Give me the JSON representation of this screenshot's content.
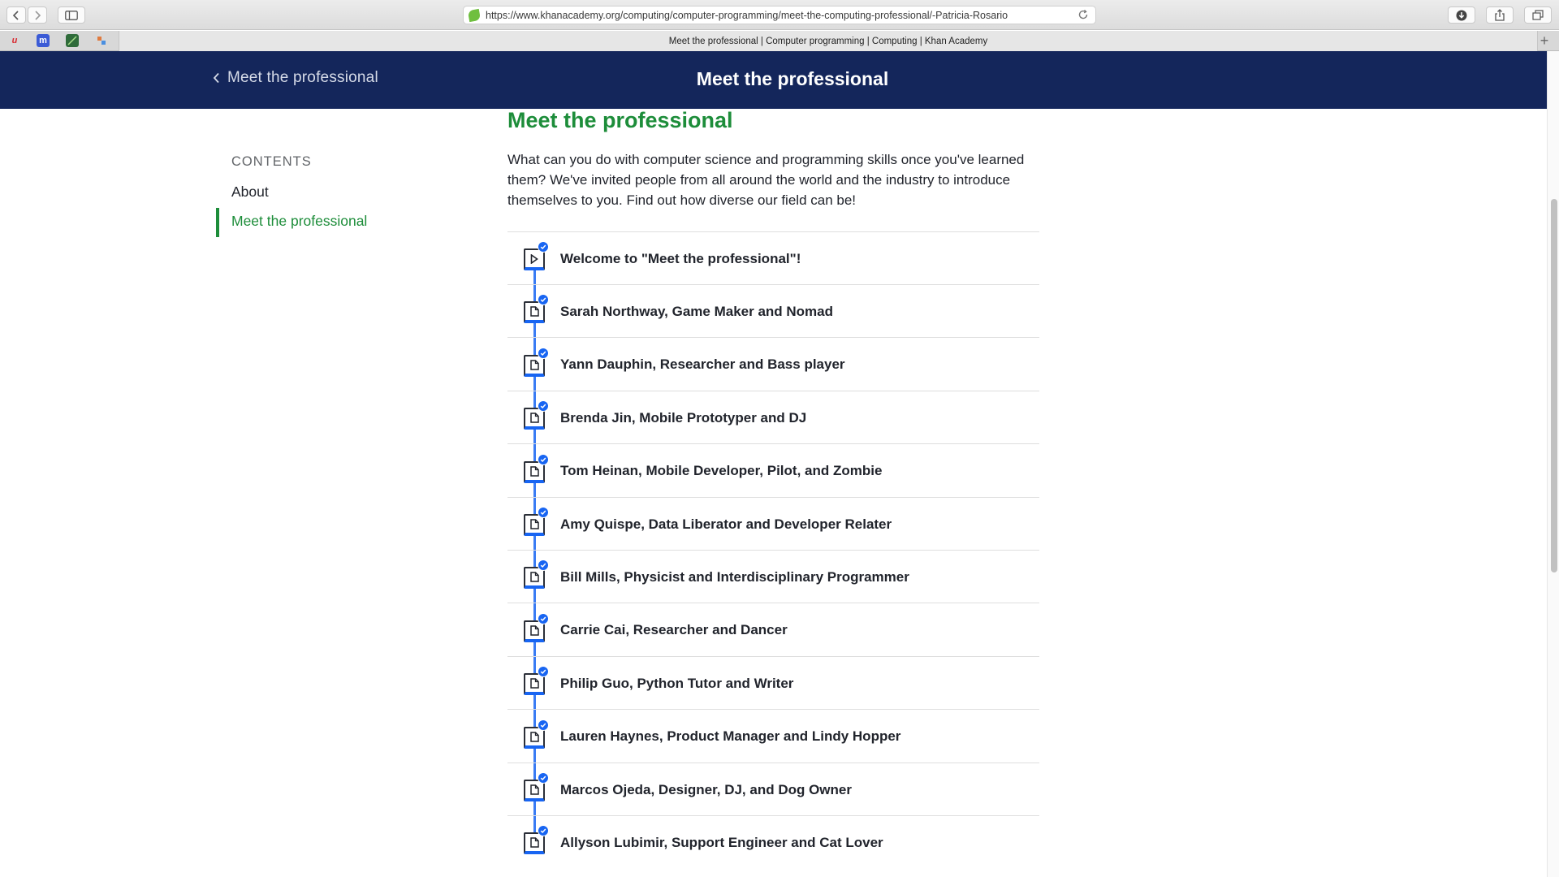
{
  "browser": {
    "url": "https://www.khanacademy.org/computing/computer-programming/meet-the-computing-professional/-Patricia-Rosario",
    "tab_title": "Meet the professional | Computer programming | Computing | Khan Academy",
    "new_tab": "+",
    "favicons": [
      {
        "name": "favicon-u",
        "glyph": "u",
        "color": "#d8282f"
      },
      {
        "name": "favicon-m",
        "glyph": "m",
        "color": "#3b5bd6"
      },
      {
        "name": "favicon-chart",
        "glyph": "",
        "color": "#2f6b3a"
      },
      {
        "name": "favicon-blocks",
        "glyph": "",
        "color": "#e07a3e"
      }
    ]
  },
  "header": {
    "back_label": "Meet the professional",
    "title": "Meet the professional"
  },
  "sidebar": {
    "contents_label": "CONTENTS",
    "items": [
      {
        "label": "About",
        "active": false
      },
      {
        "label": "Meet the professional",
        "active": true
      }
    ]
  },
  "main": {
    "title": "Meet the professional",
    "description": "What can you do with computer science and programming skills once you've learned them? We've invited people from all around the world and the industry to introduce themselves to you. Find out how diverse our field can be!",
    "items": [
      {
        "label": "Welcome to \"Meet the professional\"!",
        "type": "video",
        "completed": true
      },
      {
        "label": "Sarah Northway, Game Maker and Nomad",
        "type": "article",
        "completed": true
      },
      {
        "label": "Yann Dauphin, Researcher and Bass player",
        "type": "article",
        "completed": true
      },
      {
        "label": "Brenda Jin, Mobile Prototyper and DJ",
        "type": "article",
        "completed": true
      },
      {
        "label": "Tom Heinan, Mobile Developer, Pilot, and Zombie",
        "type": "article",
        "completed": true
      },
      {
        "label": "Amy Quispe, Data Liberator and Developer Relater",
        "type": "article",
        "completed": true
      },
      {
        "label": "Bill Mills, Physicist and Interdisciplinary Programmer",
        "type": "article",
        "completed": true
      },
      {
        "label": "Carrie Cai, Researcher and Dancer",
        "type": "article",
        "completed": true
      },
      {
        "label": "Philip Guo, Python Tutor and Writer",
        "type": "article",
        "completed": true
      },
      {
        "label": "Lauren Haynes, Product Manager and Lindy Hopper",
        "type": "article",
        "completed": true
      },
      {
        "label": "Marcos Ojeda, Designer, DJ, and Dog Owner",
        "type": "article",
        "completed": true
      },
      {
        "label": "Allyson Lubimir, Support Engineer and Cat Lover",
        "type": "article",
        "completed": true
      }
    ]
  },
  "colors": {
    "header_bg": "#14265b",
    "accent_green": "#1d8d3a",
    "progress_blue": "#1865f2"
  }
}
